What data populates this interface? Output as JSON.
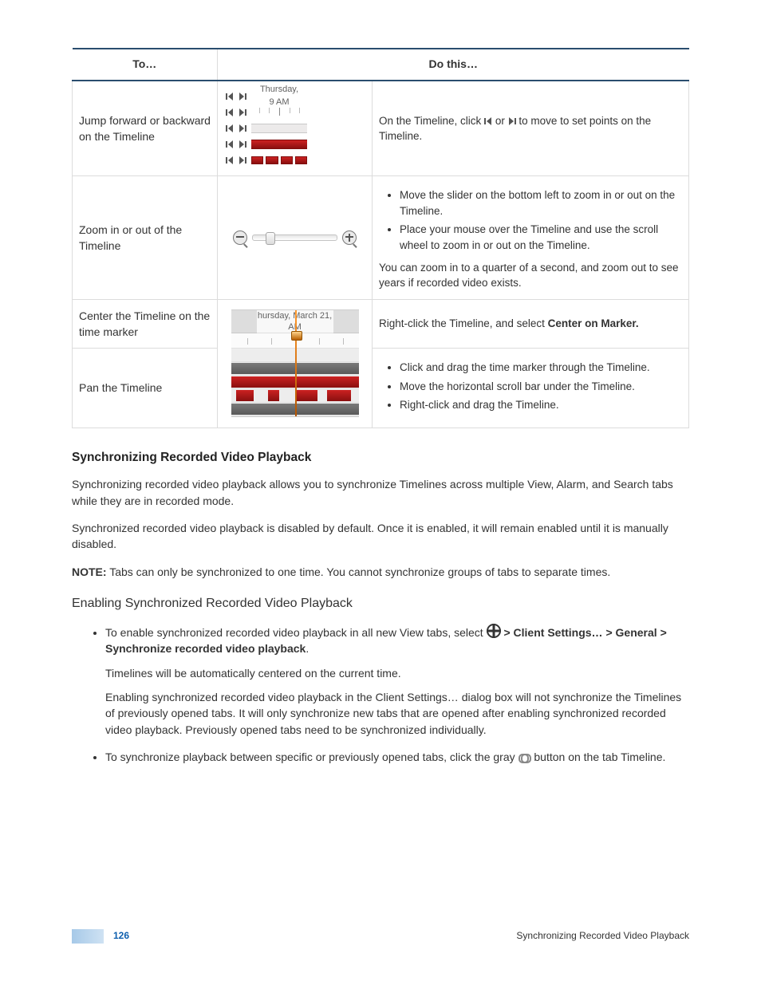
{
  "table": {
    "headers": {
      "to": "To…",
      "do": "Do this…"
    },
    "rows": {
      "jump": {
        "to": "Jump forward or backward on the Timeline",
        "do_pre": "On the Timeline, click ",
        "do_mid": " or ",
        "do_post": " to move to set points on the Timeline.",
        "img_day": "Thursday,",
        "img_time": "9 AM"
      },
      "zoom": {
        "to": "Zoom in or out of the Timeline",
        "b1": "Move the slider on the bottom left to zoom in or out on the Timeline.",
        "b2": "Place your mouse over the Timeline and use the scroll wheel to zoom in or out on the Timeline.",
        "tail": "You can zoom in to a quarter of a second, and zoom out to see years if recorded video exists."
      },
      "center": {
        "to": "Center the Timeline on the time marker",
        "do_pre": "Right-click the Timeline, and select ",
        "do_bold": "Center on Marker.",
        "img_date": "hursday, March 21,",
        "img_am": "AM"
      },
      "pan": {
        "to": "Pan the Timeline",
        "b1": "Click and drag the time marker through the Timeline.",
        "b2": "Move the horizontal scroll bar under the Timeline.",
        "b3": "Right-click and drag the Timeline."
      }
    }
  },
  "sync": {
    "h": "Synchronizing Recorded Video Playback",
    "p1": "Synchronizing recorded video playback allows you to synchronize Timelines across multiple View, Alarm, and Search tabs while they are in recorded mode.",
    "p2": "Synchronized recorded video playback is disabled by default. Once it is enabled, it will remain enabled until it is manually disabled.",
    "note_label": "NOTE:",
    "note": " Tabs can only be synchronized to one time. You cannot synchronize groups of tabs to separate times.",
    "sub": "Enabling Synchronized Recorded Video Playback",
    "li1_pre": "To enable synchronized recorded video playback in all new View tabs, select ",
    "li1_path1": " > ",
    "li1_b1": "Client Settings…",
    "li1_path2": " > ",
    "li1_b2": "General",
    "li1_path3": " > ",
    "li1_b3": "Synchronize recorded video playback",
    "li1_post": ".",
    "li1_p1": "Timelines will be automatically centered on the current time.",
    "li1_p2": "Enabling synchronized recorded video playback in the Client Settings… dialog box will not synchronize the Timelines of previously opened tabs. It will only synchronize new tabs that are opened after enabling synchronized recorded video playback. Previously opened tabs need to be synchronized individually.",
    "li2_pre": "To synchronize playback between specific or previously opened tabs, click the gray ",
    "li2_post": " button on the tab Timeline."
  },
  "footer": {
    "page": "126",
    "title": "Synchronizing Recorded Video Playback"
  }
}
